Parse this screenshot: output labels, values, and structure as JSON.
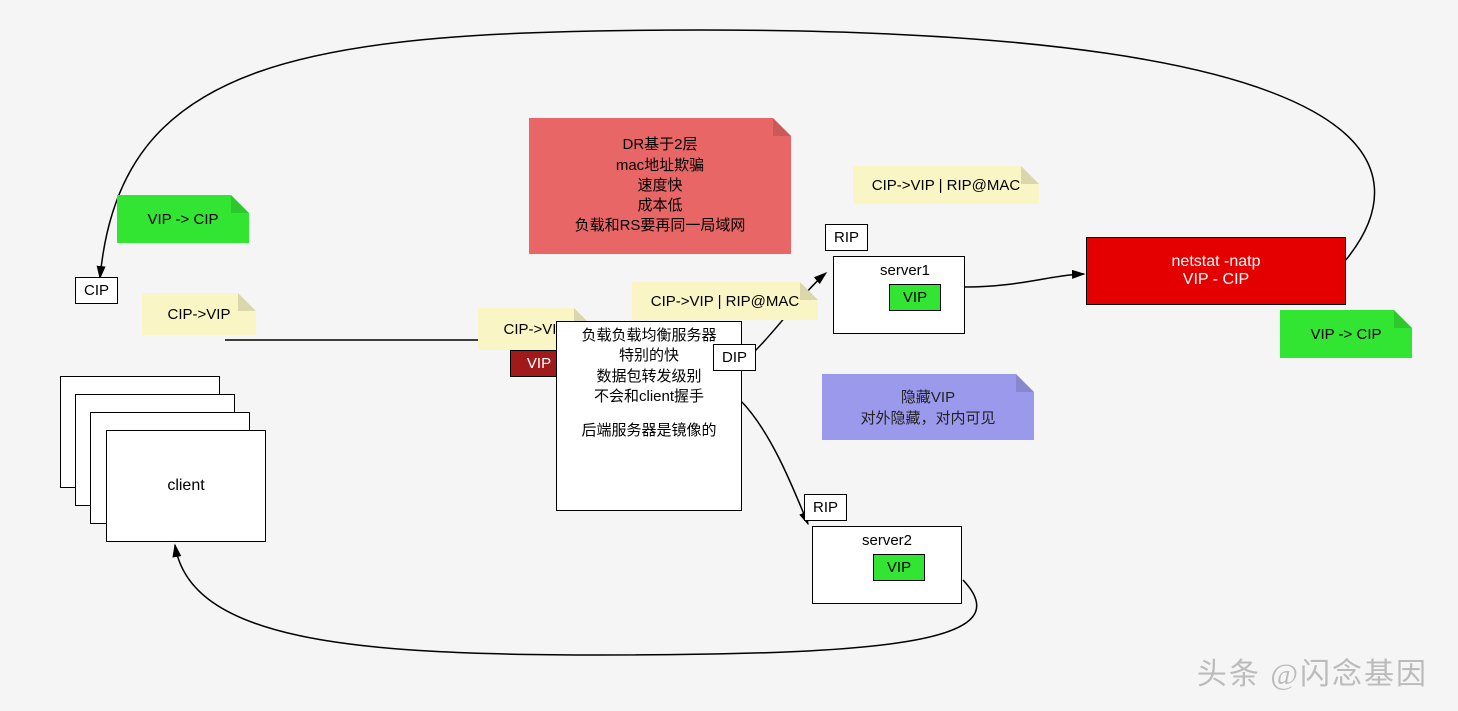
{
  "notes": {
    "vip_cip_top": "VIP -> CIP",
    "cip_vip_client": "CIP->VIP",
    "cip_vip_lb": "CIP->VIP",
    "cip_vip_rip_mac_1": "CIP->VIP | RIP@MAC",
    "cip_vip_rip_mac_2": "CIP->VIP | RIP@MAC",
    "vip_cip_right": "VIP -> CIP",
    "hidden_vip_l1": "隐藏VIP",
    "hidden_vip_l2": "对外隐藏，对内可见",
    "dr_l1": "DR基于2层",
    "dr_l2": "mac地址欺骗",
    "dr_l3": "速度快",
    "dr_l4": "成本低",
    "dr_l5": "负载和RS要再同一局域网"
  },
  "labels": {
    "cip": "CIP",
    "client": "client",
    "dip": "DIP",
    "rip": "RIP",
    "vip": "VIP",
    "server1": "server1",
    "server2": "server2",
    "lb_l1": "负载负载均衡服务器",
    "lb_l2": "特别的快",
    "lb_l3": "数据包转发级别",
    "lb_l4": "不会和client握手",
    "lb_l5": "后端服务器是镜像的",
    "netstat_l1": "netstat -natp",
    "netstat_l2": "VIP - CIP"
  },
  "watermark": "头条 @闪念基因"
}
